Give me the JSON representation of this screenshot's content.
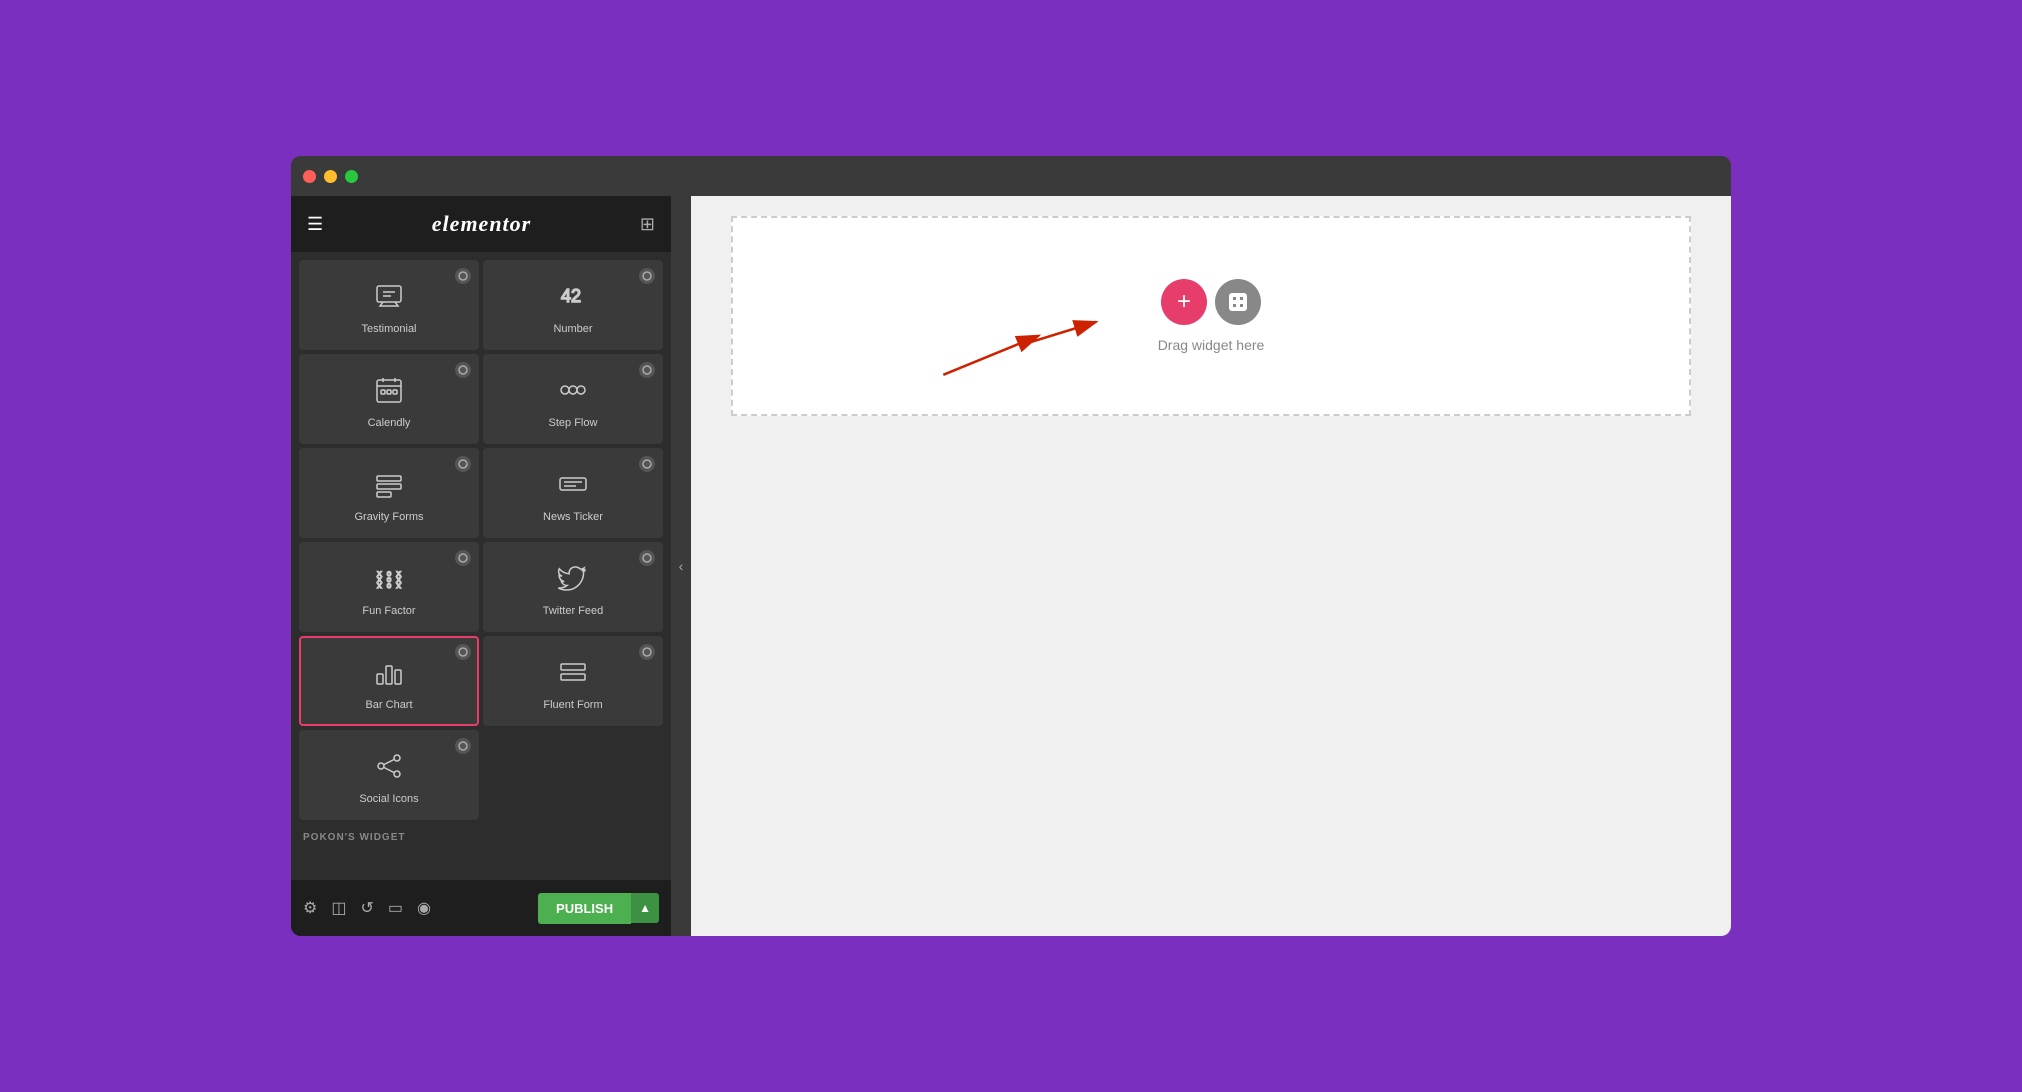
{
  "window": {
    "title": "Elementor"
  },
  "sidebar": {
    "logo": "elementor",
    "widgets": [
      {
        "id": "testimonial",
        "label": "Testimonial",
        "icon": "testimonial",
        "pro": true
      },
      {
        "id": "number",
        "label": "Number",
        "icon": "number",
        "pro": true
      },
      {
        "id": "calendly",
        "label": "Calendly",
        "icon": "calendly",
        "pro": true
      },
      {
        "id": "step-flow",
        "label": "Step Flow",
        "icon": "stepflow",
        "pro": true
      },
      {
        "id": "gravity-forms",
        "label": "Gravity Forms",
        "icon": "gravityforms",
        "pro": true
      },
      {
        "id": "news-ticker",
        "label": "News Ticker",
        "icon": "newsticker",
        "pro": true
      },
      {
        "id": "fun-factor",
        "label": "Fun Factor",
        "icon": "funfactor",
        "pro": true
      },
      {
        "id": "twitter-feed",
        "label": "Twitter Feed",
        "icon": "twitterfeed",
        "pro": true
      },
      {
        "id": "bar-chart",
        "label": "Bar Chart",
        "icon": "barchart",
        "pro": true,
        "selected": true
      },
      {
        "id": "fluent-form",
        "label": "Fluent Form",
        "icon": "fluentform",
        "pro": true
      },
      {
        "id": "social-icons",
        "label": "Social Icons",
        "icon": "socialicons",
        "pro": true
      }
    ],
    "section_label": "POKON'S WIDGET",
    "footer": {
      "publish_label": "PUBLISH",
      "dropdown_arrow": "▲"
    }
  },
  "canvas": {
    "drop_label": "Drag widget here"
  },
  "arrows": {
    "arrow1_label": "",
    "arrow2_label": ""
  }
}
